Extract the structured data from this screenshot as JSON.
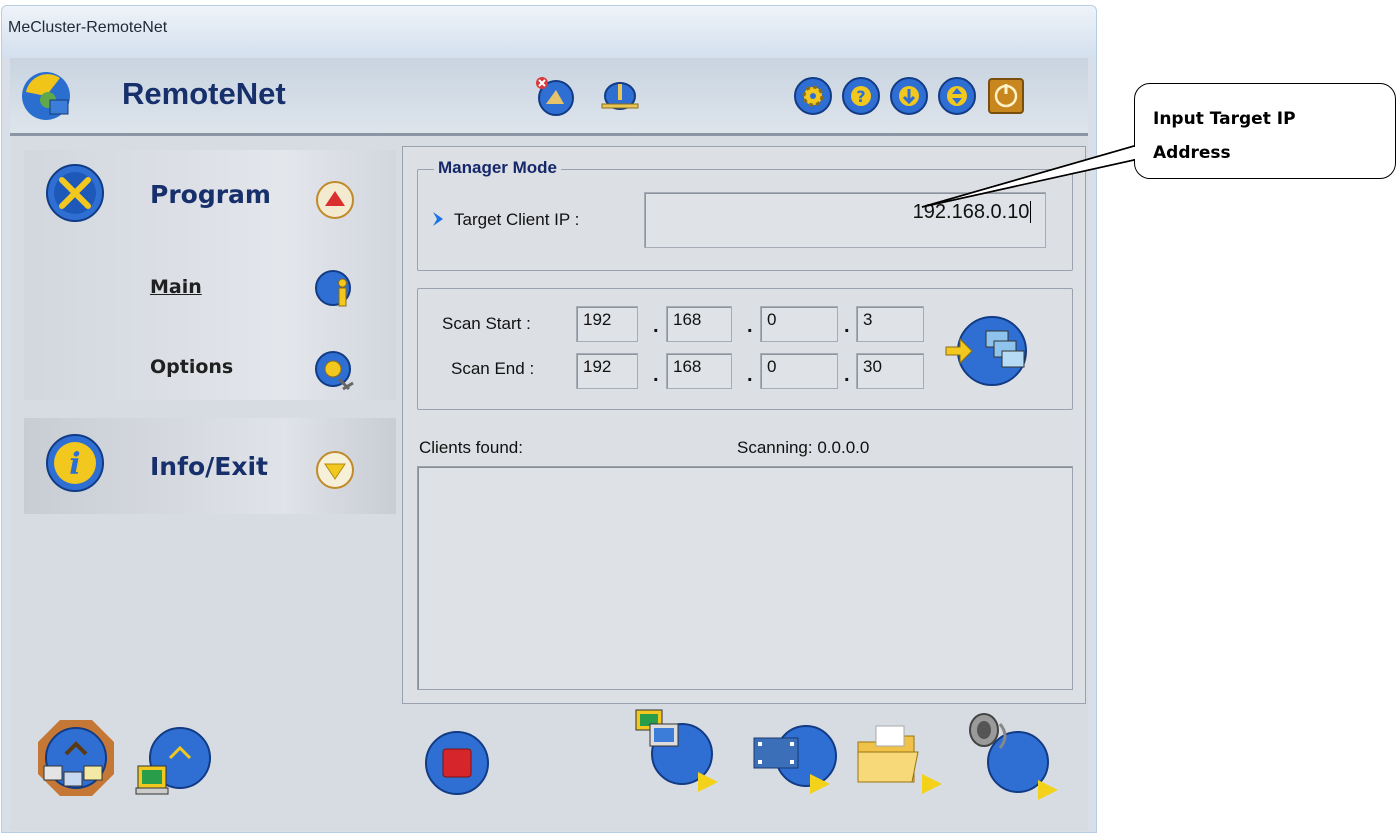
{
  "window": {
    "title": "MeCluster-RemoteNet"
  },
  "app": {
    "name": "RemoteNet"
  },
  "toolbar": {
    "icons": [
      "disconnect-icon",
      "network-icon",
      "settings-icon",
      "help-icon",
      "download-icon",
      "updown-icon",
      "power-icon"
    ]
  },
  "sidebar": {
    "program": {
      "label": "Program",
      "items": [
        {
          "label": "Main"
        },
        {
          "label": "Options"
        }
      ]
    },
    "info": {
      "label": "Info/Exit"
    }
  },
  "manager": {
    "legend": "Manager Mode",
    "target_label": "Target Client IP :",
    "target_ip": "192.168.0.10"
  },
  "scan": {
    "start_label": "Scan Start :",
    "end_label": "Scan End :",
    "start": [
      "192",
      "168",
      "0",
      "3"
    ],
    "end": [
      "192",
      "168",
      "0",
      "30"
    ],
    "separator": "."
  },
  "status": {
    "clients_found_label": "Clients found:",
    "scanning_text": "Scanning: 0.0.0.0"
  },
  "callout": {
    "line1": "Input Target IP",
    "line2": "Address"
  },
  "colors": {
    "accent": "#17306b",
    "button_blue": "#2f6fd3",
    "stop_red": "#d6262b",
    "arrow_yellow": "#f4d21a"
  }
}
